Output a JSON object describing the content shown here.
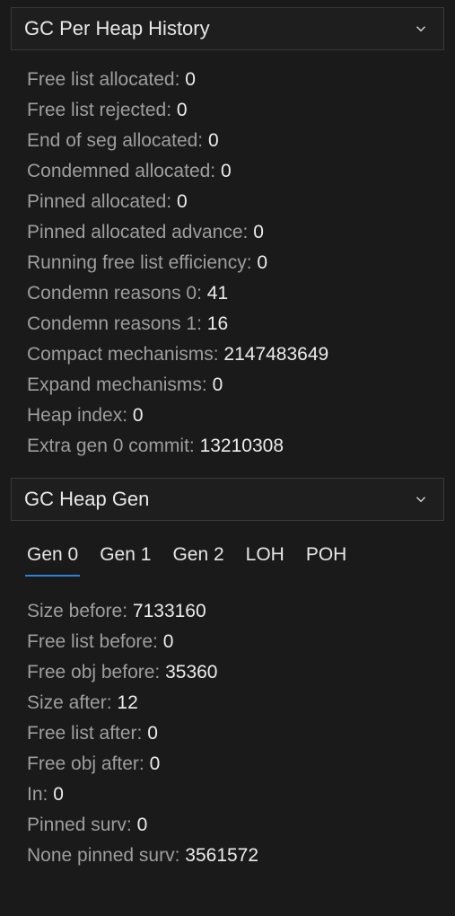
{
  "sections": {
    "per_heap_history": {
      "title": "GC Per Heap History",
      "rows": [
        {
          "label": "Free list allocated: ",
          "value": "0"
        },
        {
          "label": "Free list rejected: ",
          "value": "0"
        },
        {
          "label": "End of seg allocated: ",
          "value": "0"
        },
        {
          "label": "Condemned allocated: ",
          "value": "0"
        },
        {
          "label": "Pinned allocated: ",
          "value": "0"
        },
        {
          "label": "Pinned allocated advance: ",
          "value": "0"
        },
        {
          "label": "Running free list efficiency: ",
          "value": "0"
        },
        {
          "label": "Condemn reasons 0: ",
          "value": "41"
        },
        {
          "label": "Condemn reasons 1: ",
          "value": "16"
        },
        {
          "label": "Compact mechanisms: ",
          "value": "2147483649"
        },
        {
          "label": "Expand mechanisms: ",
          "value": "0"
        },
        {
          "label": "Heap index: ",
          "value": "0"
        },
        {
          "label": "Extra gen 0 commit: ",
          "value": "13210308"
        }
      ]
    },
    "heap_gen": {
      "title": "GC Heap Gen",
      "tabs": [
        {
          "label": "Gen 0",
          "active": true
        },
        {
          "label": "Gen 1",
          "active": false
        },
        {
          "label": "Gen 2",
          "active": false
        },
        {
          "label": "LOH",
          "active": false
        },
        {
          "label": "POH",
          "active": false
        }
      ],
      "rows": [
        {
          "label": "Size before: ",
          "value": "7133160"
        },
        {
          "label": "Free list before: ",
          "value": "0"
        },
        {
          "label": "Free obj before: ",
          "value": "35360"
        },
        {
          "label": "Size after: ",
          "value": "12"
        },
        {
          "label": "Free list after: ",
          "value": "0"
        },
        {
          "label": "Free obj after: ",
          "value": "0"
        },
        {
          "label": "In: ",
          "value": "0"
        },
        {
          "label": "Pinned surv: ",
          "value": "0"
        },
        {
          "label": "None pinned surv: ",
          "value": "3561572"
        }
      ]
    }
  }
}
